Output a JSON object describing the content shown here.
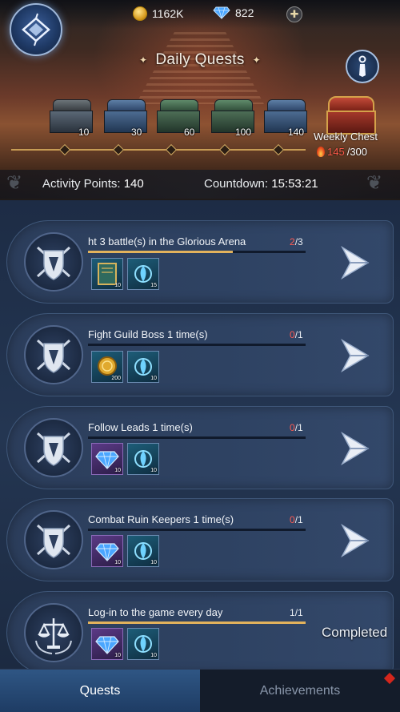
{
  "header": {
    "title": "Daily Quests",
    "currencies": [
      {
        "icon": "gold-coin-icon",
        "value": "1162K"
      },
      {
        "icon": "diamond-icon",
        "value": "822"
      }
    ],
    "chests": [
      {
        "label": "10",
        "style": "brown"
      },
      {
        "label": "30",
        "style": "blue"
      },
      {
        "label": "60",
        "style": "green"
      },
      {
        "label": "100",
        "style": "green"
      },
      {
        "label": "140",
        "style": "blue"
      }
    ],
    "weekly_chest": {
      "label": "Weekly Chest",
      "current": "145",
      "total": "/300"
    },
    "activity_points_label": "Activity Points:",
    "activity_points_value": "140",
    "countdown_label": "Countdown:",
    "countdown_value": "15:53:21"
  },
  "quests": [
    {
      "title": "ht 3 battle(s) in the Glorious Arena",
      "current": "2",
      "total": "/3",
      "progress": 0.667,
      "rewards": [
        {
          "icon": "book-icon",
          "qty": "10",
          "style": "blue"
        },
        {
          "icon": "spirit-flame-icon",
          "qty": "15",
          "style": "blue"
        }
      ],
      "emblem": "crossed-swords-shield-icon",
      "action": "go"
    },
    {
      "title": "Fight Guild Boss 1 time(s)",
      "current": "0",
      "total": "/1",
      "progress": 0,
      "rewards": [
        {
          "icon": "gold-coin-icon",
          "qty": "200",
          "style": "blue"
        },
        {
          "icon": "spirit-flame-icon",
          "qty": "10",
          "style": "blue"
        }
      ],
      "emblem": "crossed-swords-shield-icon",
      "action": "go"
    },
    {
      "title": "Follow Leads 1 time(s)",
      "current": "0",
      "total": "/1",
      "progress": 0,
      "rewards": [
        {
          "icon": "diamond-icon",
          "qty": "10",
          "style": "purple"
        },
        {
          "icon": "spirit-flame-icon",
          "qty": "10",
          "style": "blue"
        }
      ],
      "emblem": "crossed-swords-shield-icon",
      "action": "go"
    },
    {
      "title": "Combat Ruin Keepers 1 time(s)",
      "current": "0",
      "total": "/1",
      "progress": 0,
      "rewards": [
        {
          "icon": "diamond-icon",
          "qty": "10",
          "style": "purple"
        },
        {
          "icon": "spirit-flame-icon",
          "qty": "10",
          "style": "blue"
        }
      ],
      "emblem": "crossed-swords-shield-icon",
      "action": "go"
    },
    {
      "title": "Log-in to the game every day",
      "current": "1",
      "total": "/1",
      "progress": 1,
      "rewards": [
        {
          "icon": "diamond-icon",
          "qty": "10",
          "style": "purple"
        },
        {
          "icon": "spirit-flame-icon",
          "qty": "10",
          "style": "blue"
        }
      ],
      "emblem": "scales-laurel-icon",
      "action": "completed",
      "completed_label": "Completed"
    }
  ],
  "tabs": [
    {
      "label": "Quests",
      "active": true
    },
    {
      "label": "Achievements",
      "active": false,
      "badge": true
    }
  ],
  "colors": {
    "accent_gold": "#e2b25c",
    "alert_red": "#ff5b52",
    "active_tab": "#2f5684"
  }
}
